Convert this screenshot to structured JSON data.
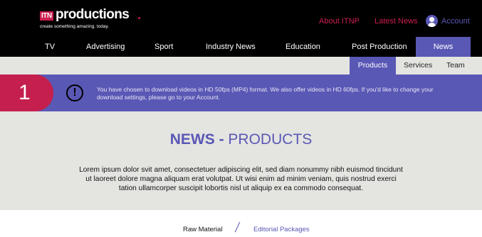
{
  "brand": {
    "logo_box": "ITN",
    "logo_word": "productions",
    "tagline": "create something amazing. today."
  },
  "top_links": {
    "about": "About ITNP",
    "latest_news": "Latest News",
    "account": "Account",
    "account_icon": "user-icon"
  },
  "main_nav": [
    {
      "label": "TV"
    },
    {
      "label": "Advertising"
    },
    {
      "label": "Sport"
    },
    {
      "label": "Industry News"
    },
    {
      "label": "Education"
    },
    {
      "label": "Post Production"
    },
    {
      "label": "News",
      "active": true
    }
  ],
  "sub_nav": [
    {
      "label": "Products",
      "active": true
    },
    {
      "label": "Services"
    },
    {
      "label": "Team"
    }
  ],
  "notice": {
    "number": "1",
    "icon": "exclamation-icon",
    "text": "You have chosen to download videos in HD 50fps (MP4) format. We also offer videos in HD 60fps. If you'd like to change your download settings, please go to your Account."
  },
  "page": {
    "title_strong": "NEWS -",
    "title_light": "PRODUCTS",
    "intro": "Lorem ipsum dolor svit amet, consectetuer adipiscing elit, sed diam nonummy nibh euismod tincidunt ut laoreet dolore magna aliquam erat volutpat. Ut wisi enim ad minim veniam, quis nostrud exerci tation ullamcorper suscipit lobortis nisl ut aliquip ex ea commodo consequat."
  },
  "tabs": {
    "raw_material": "Raw Material",
    "editorial_packages": "Editorial Packages"
  },
  "colors": {
    "brand_red": "#cc1f4f",
    "brand_purple": "#5a58b5",
    "header_bg": "#000000",
    "grey_bg": "#e4e4e1"
  }
}
